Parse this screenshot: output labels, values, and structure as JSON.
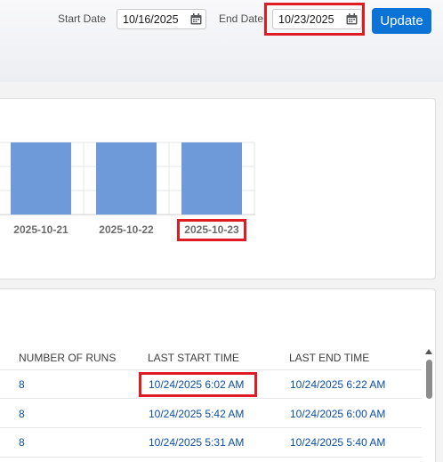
{
  "filters": {
    "start_label": "Start Date",
    "start_value": "10/16/2025",
    "end_label": "End Date",
    "end_value": "10/23/2025",
    "update_label": "Update"
  },
  "chart_data": {
    "type": "bar",
    "categories": [
      "2025-10-21",
      "2025-10-22",
      "2025-10-23"
    ],
    "values": [
      1,
      1,
      1
    ],
    "bar_color": "#6e9ada"
  },
  "table": {
    "columns": [
      "NUMBER OF RUNS",
      "LAST START TIME",
      "LAST END TIME"
    ],
    "rows": [
      {
        "runs": "8",
        "start": "10/24/2025 6:02 AM",
        "end": "10/24/2025 6:22 AM"
      },
      {
        "runs": "8",
        "start": "10/24/2025 5:42 AM",
        "end": "10/24/2025 6:00 AM"
      },
      {
        "runs": "8",
        "start": "10/24/2025 5:31 AM",
        "end": "10/24/2025 5:40 AM"
      }
    ]
  },
  "colors": {
    "accent": "#0b72d6",
    "highlight": "#e01b24",
    "link": "#0b4fa3"
  }
}
